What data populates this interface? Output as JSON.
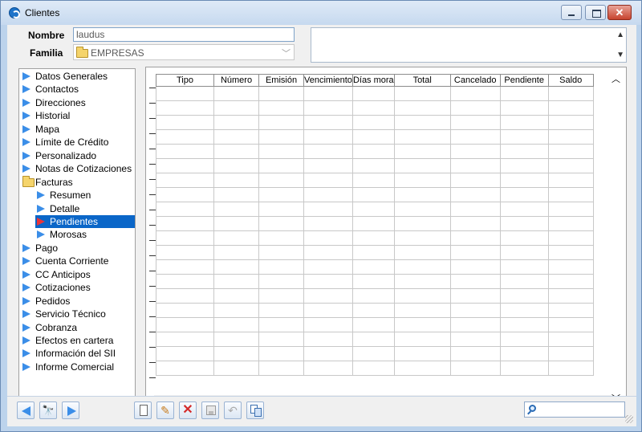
{
  "window": {
    "title": "Clientes",
    "controls": {
      "minimize": "minimize",
      "maximize": "maximize",
      "close": "✕"
    }
  },
  "form": {
    "nombre_label": "Nombre",
    "nombre_value": "laudus",
    "familia_label": "Familia",
    "familia_value": "EMPRESAS"
  },
  "tree": {
    "items": [
      {
        "label": "Datos Generales",
        "level": 0,
        "icon": "arrow"
      },
      {
        "label": "Contactos",
        "level": 0,
        "icon": "arrow"
      },
      {
        "label": "Direcciones",
        "level": 0,
        "icon": "arrow"
      },
      {
        "label": "Historial",
        "level": 0,
        "icon": "arrow"
      },
      {
        "label": "Mapa",
        "level": 0,
        "icon": "arrow"
      },
      {
        "label": "Límite de Crédito",
        "level": 0,
        "icon": "arrow"
      },
      {
        "label": "Personalizado",
        "level": 0,
        "icon": "arrow"
      },
      {
        "label": "Notas de Cotizaciones",
        "level": 0,
        "icon": "arrow"
      },
      {
        "label": "Facturas",
        "level": 0,
        "icon": "folder"
      },
      {
        "label": "Resumen",
        "level": 1,
        "icon": "arrow"
      },
      {
        "label": "Detalle",
        "level": 1,
        "icon": "arrow"
      },
      {
        "label": "Pendientes",
        "level": 1,
        "icon": "arrow-red",
        "selected": true
      },
      {
        "label": "Morosas",
        "level": 1,
        "icon": "arrow"
      },
      {
        "label": "Pago",
        "level": 0,
        "icon": "arrow"
      },
      {
        "label": "Cuenta Corriente",
        "level": 0,
        "icon": "arrow"
      },
      {
        "label": "CC Anticipos",
        "level": 0,
        "icon": "arrow"
      },
      {
        "label": "Cotizaciones",
        "level": 0,
        "icon": "arrow"
      },
      {
        "label": "Pedidos",
        "level": 0,
        "icon": "arrow"
      },
      {
        "label": "Servicio Técnico",
        "level": 0,
        "icon": "arrow"
      },
      {
        "label": "Cobranza",
        "level": 0,
        "icon": "arrow"
      },
      {
        "label": "Efectos en cartera",
        "level": 0,
        "icon": "arrow"
      },
      {
        "label": "Información del SII",
        "level": 0,
        "icon": "arrow"
      },
      {
        "label": "Informe Comercial",
        "level": 0,
        "icon": "arrow"
      }
    ]
  },
  "grid": {
    "columns": [
      "Tipo",
      "Número",
      "Emisión",
      "Vencimiento",
      "Días mora",
      "Total",
      "Cancelado",
      "Pendiente",
      "Saldo"
    ],
    "rows": [],
    "scroll_up": "^",
    "scroll_down": "v",
    "scroll_left": "<",
    "scroll_right": ">"
  },
  "toolbar": {
    "binoculars_glyph": "🔭",
    "edit_glyph": "✎",
    "delete_glyph": "✕",
    "undo_glyph": "↶",
    "search_value": ""
  },
  "colors": {
    "accent": "#3b8ee8",
    "selection": "#0a66c8",
    "delete_red": "#d42a2a"
  }
}
